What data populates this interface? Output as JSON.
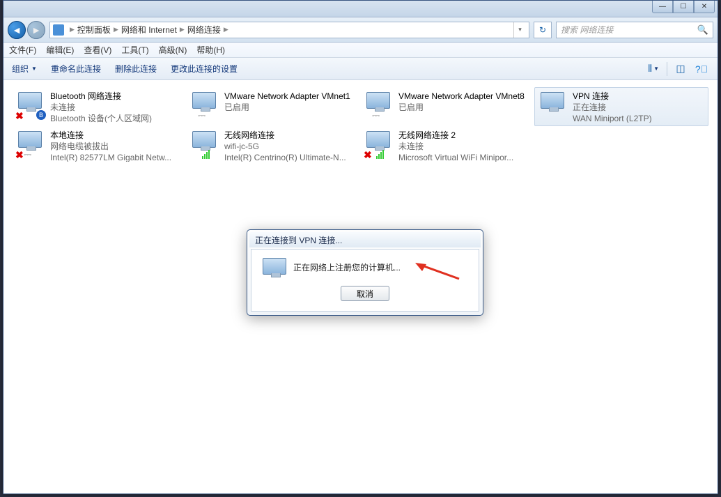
{
  "window_controls": {
    "min": "—",
    "max": "☐",
    "close": "✕"
  },
  "breadcrumb": {
    "items": [
      "控制面板",
      "网络和 Internet",
      "网络连接"
    ]
  },
  "search": {
    "placeholder": "搜索 网络连接"
  },
  "menubar": [
    "文件(F)",
    "编辑(E)",
    "查看(V)",
    "工具(T)",
    "高级(N)",
    "帮助(H)"
  ],
  "toolbar": {
    "organize": "组织",
    "rename": "重命名此连接",
    "delete": "删除此连接",
    "change": "更改此连接的设置"
  },
  "connections": [
    {
      "title": "Bluetooth 网络连接",
      "status": "未连接",
      "detail": "Bluetooth 设备(个人区域网)",
      "overlay": "x_bt"
    },
    {
      "title": "VMware Network Adapter VMnet1",
      "status": "已启用",
      "detail": "",
      "overlay": "cable"
    },
    {
      "title": "VMware Network Adapter VMnet8",
      "status": "已启用",
      "detail": "",
      "overlay": "cable"
    },
    {
      "title": "VPN 连接",
      "status": "正在连接",
      "detail": "WAN Miniport (L2TP)",
      "overlay": "none",
      "selected": true
    },
    {
      "title": "本地连接",
      "status": "网络电缆被拔出",
      "detail": "Intel(R) 82577LM Gigabit Netw...",
      "overlay": "x_cable"
    },
    {
      "title": "无线网络连接",
      "status": "wifi-jc-5G",
      "detail": "Intel(R) Centrino(R) Ultimate-N...",
      "overlay": "signal"
    },
    {
      "title": "无线网络连接 2",
      "status": "未连接",
      "detail": "Microsoft Virtual WiFi Minipor...",
      "overlay": "x_signal"
    }
  ],
  "dialog": {
    "title": "正在连接到 VPN 连接...",
    "message": "正在网络上注册您的计算机...",
    "cancel": "取消"
  }
}
